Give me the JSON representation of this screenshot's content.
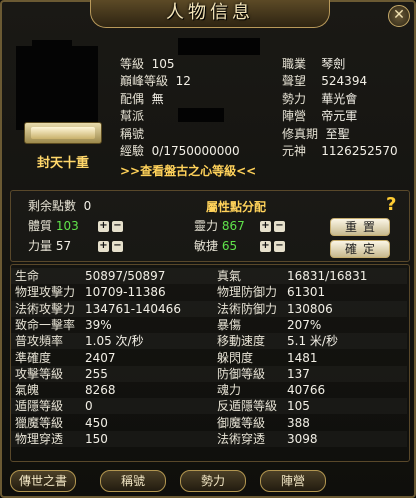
{
  "window": {
    "title": "人物信息"
  },
  "profile": {
    "rank_name": "封天十重",
    "left_rows": [
      {
        "label": "等級",
        "value": "105"
      },
      {
        "label": "巔峰等級",
        "value": "12"
      },
      {
        "label": "配偶",
        "value": "無"
      },
      {
        "label": "幫派",
        "value": ""
      },
      {
        "label": "稱號",
        "value": ""
      },
      {
        "label": "經驗",
        "value": "0/1750000000"
      }
    ],
    "right_rows": [
      {
        "label": "職業",
        "value": "琴劍"
      },
      {
        "label": "聲望",
        "value": "524394"
      },
      {
        "label": "勢力",
        "value": "華光會"
      },
      {
        "label": "陣營",
        "value": "帝元軍"
      },
      {
        "label": "修真期",
        "value": "至聖"
      },
      {
        "label": "元神",
        "value": "1126252570"
      }
    ],
    "view_link": ">>查看盤古之心等級<<"
  },
  "attributes": {
    "remaining_label": "剩余點數",
    "remaining_value": "0",
    "assign_title": "屬性點分配",
    "stats": [
      {
        "label": "體質",
        "value": "103",
        "color": "#5fe24a"
      },
      {
        "label": "力量",
        "value": "57",
        "color": "#f2efe6"
      },
      {
        "label": "靈力",
        "value": "867",
        "color": "#5fe24a"
      },
      {
        "label": "敏捷",
        "value": "65",
        "color": "#5fe24a"
      }
    ],
    "reset_label": "重置",
    "confirm_label": "確定",
    "help_symbol": "?"
  },
  "stats_table": [
    {
      "l_label": "生命",
      "l_value": "50897/50897",
      "r_label": "真氣",
      "r_value": "16831/16831"
    },
    {
      "l_label": "物理攻擊力",
      "l_value": "10709-11386",
      "r_label": "物理防御力",
      "r_value": "61301"
    },
    {
      "l_label": "法術攻擊力",
      "l_value": "134761-140466",
      "r_label": "法術防御力",
      "r_value": "130806"
    },
    {
      "l_label": "致命一擊率",
      "l_value": "39%",
      "r_label": "暴傷",
      "r_value": "207%"
    },
    {
      "l_label": "普攻頻率",
      "l_value": "1.05 次/秒",
      "r_label": "移動速度",
      "r_value": "5.1 米/秒"
    },
    {
      "l_label": "準確度",
      "l_value": "2407",
      "r_label": "躲閃度",
      "r_value": "1481"
    },
    {
      "l_label": "攻擊等級",
      "l_value": "255",
      "r_label": "防御等級",
      "r_value": "137"
    },
    {
      "l_label": "氣魄",
      "l_value": "8268",
      "r_label": "魂力",
      "r_value": "40766"
    },
    {
      "l_label": "遁隱等級",
      "l_value": "0",
      "r_label": "反遁隱等級",
      "r_value": "105"
    },
    {
      "l_label": "獵魔等級",
      "l_value": "450",
      "r_label": "御魔等級",
      "r_value": "388"
    },
    {
      "l_label": "物理穿透",
      "l_value": "150",
      "r_label": "法術穿透",
      "r_value": "3098"
    }
  ],
  "tabs": [
    {
      "label": "傳世之書"
    },
    {
      "label": "稱號"
    },
    {
      "label": "勢力"
    },
    {
      "label": "陣營"
    }
  ],
  "icons": {
    "close": "close-icon",
    "help": "help-icon",
    "plus": "plus-icon",
    "minus": "minus-icon"
  }
}
